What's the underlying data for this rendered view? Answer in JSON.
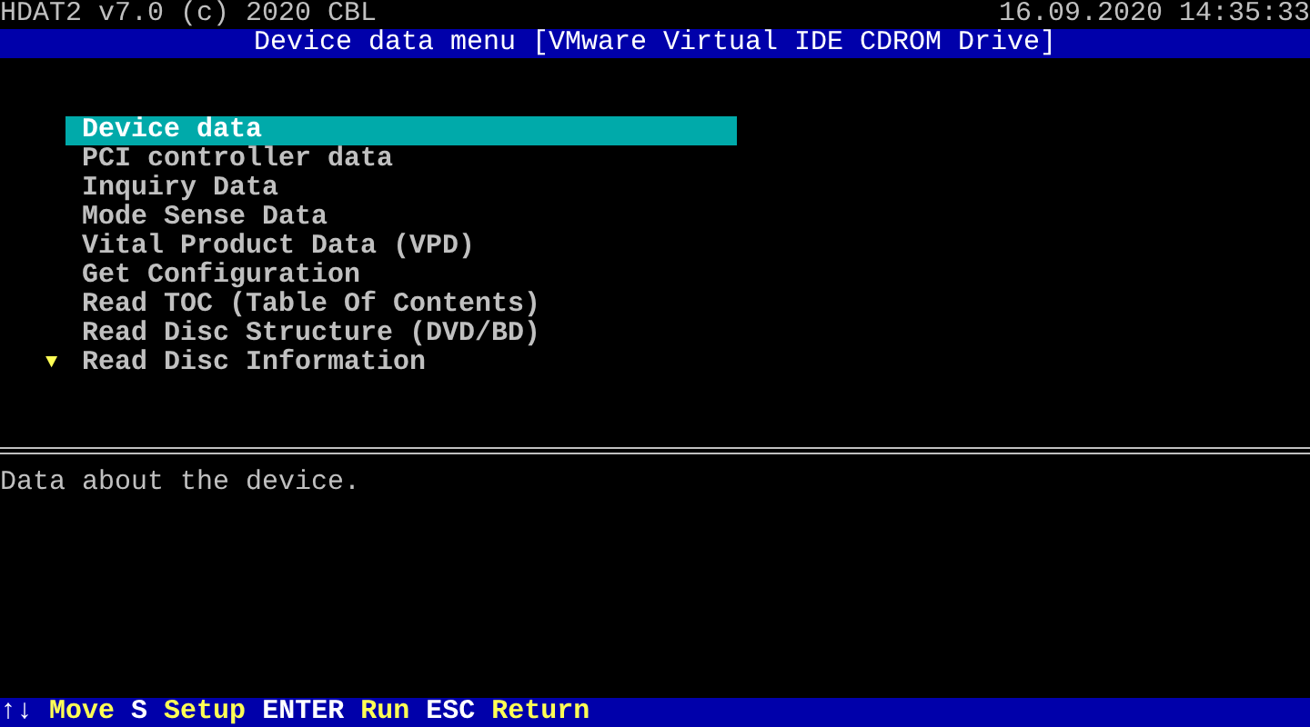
{
  "header": {
    "app": "HDAT2 v7.0 (c) 2020 CBL",
    "datetime": "16.09.2020 14:35:33"
  },
  "menu_title": "Device data menu [VMware Virtual IDE CDROM Drive]",
  "menu": {
    "items": [
      {
        "label": "Device data",
        "selected": true
      },
      {
        "label": "PCI controller data",
        "selected": false
      },
      {
        "label": "Inquiry Data",
        "selected": false
      },
      {
        "label": "Mode Sense Data",
        "selected": false
      },
      {
        "label": "Vital Product Data (VPD)",
        "selected": false
      },
      {
        "label": "Get Configuration",
        "selected": false
      },
      {
        "label": "Read TOC (Table Of Contents)",
        "selected": false
      },
      {
        "label": "Read Disc Structure (DVD/BD)",
        "selected": false
      },
      {
        "label": "Read Disc Information",
        "selected": false
      }
    ],
    "more_below": "▼"
  },
  "description": "Data about the device.",
  "footer": [
    {
      "key": "↑↓",
      "action": "Move"
    },
    {
      "key": "S",
      "action": "Setup"
    },
    {
      "key": "ENTER",
      "action": "Run"
    },
    {
      "key": "ESC",
      "action": "Return"
    }
  ]
}
